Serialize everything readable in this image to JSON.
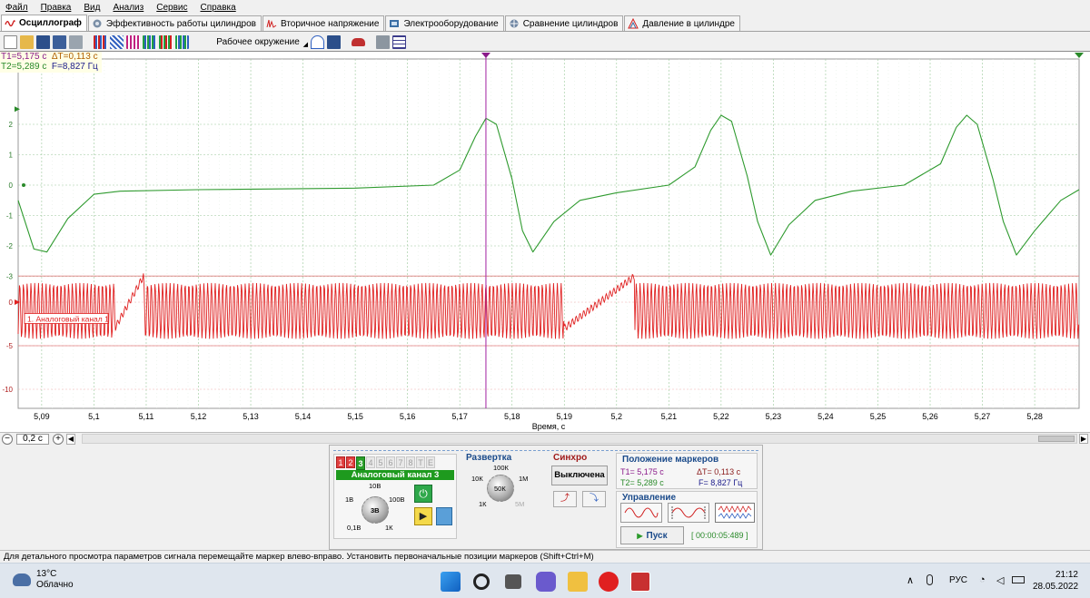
{
  "menu": [
    "Файл",
    "Правка",
    "Вид",
    "Анализ",
    "Сервис",
    "Справка"
  ],
  "tabs": [
    {
      "label": "Осциллограф",
      "icon": "oscilloscope-icon",
      "active": true
    },
    {
      "label": "Эффективность работы цилиндров",
      "icon": "cylinder-efficiency-icon"
    },
    {
      "label": "Вторичное напряжение",
      "icon": "secondary-voltage-icon"
    },
    {
      "label": "Электрооборудование",
      "icon": "electrical-equipment-icon"
    },
    {
      "label": "Сравнение цилиндров",
      "icon": "cylinder-compare-icon"
    },
    {
      "label": "Давление в цилиндре",
      "icon": "cylinder-pressure-icon"
    }
  ],
  "toolbar": {
    "environment": "Рабочее окружение"
  },
  "markers": {
    "t1": "T1=5,175 c",
    "dt": "ΔT=0,113 c",
    "t2": "T2=5,289 c",
    "f": "F=8,827 Гц"
  },
  "chart_data": {
    "type": "line",
    "xlabel": "Время, с",
    "x_ticks": [
      "5,09",
      "5,1",
      "5,11",
      "5,12",
      "5,13",
      "5,14",
      "5,15",
      "5,16",
      "5,17",
      "5,18",
      "5,19",
      "5,2",
      "5,21",
      "5,22",
      "5,23",
      "5,24",
      "5,25",
      "5,26",
      "5,27",
      "5,28"
    ],
    "xlim": [
      5.0855,
      5.2885
    ],
    "green_y_ticks": [
      "2",
      "1",
      "0",
      "-1",
      "-2",
      "-3"
    ],
    "red_y_ticks": [
      "0",
      "-5",
      "-10"
    ],
    "channel_label": "1. Аналоговый канал 1",
    "cursor_x": 5.175,
    "series": [
      {
        "color": "#2e9a2e",
        "description": "green channel",
        "points": [
          [
            5.0855,
            -0.5
          ],
          [
            5.0885,
            -2.1
          ],
          [
            5.091,
            -2.2
          ],
          [
            5.095,
            -1.1
          ],
          [
            5.1,
            -0.3
          ],
          [
            5.105,
            -0.2
          ],
          [
            5.12,
            -0.15
          ],
          [
            5.15,
            -0.1
          ],
          [
            5.165,
            0
          ],
          [
            5.17,
            0.5
          ],
          [
            5.173,
            1.6
          ],
          [
            5.175,
            2.2
          ],
          [
            5.177,
            2.0
          ],
          [
            5.18,
            0.2
          ],
          [
            5.182,
            -1.5
          ],
          [
            5.184,
            -2.2
          ],
          [
            5.188,
            -1.2
          ],
          [
            5.193,
            -0.5
          ],
          [
            5.2,
            -0.25
          ],
          [
            5.21,
            0
          ],
          [
            5.215,
            0.6
          ],
          [
            5.218,
            1.8
          ],
          [
            5.22,
            2.3
          ],
          [
            5.222,
            2.1
          ],
          [
            5.225,
            0.3
          ],
          [
            5.227,
            -1.2
          ],
          [
            5.2295,
            -2.3
          ],
          [
            5.233,
            -1.3
          ],
          [
            5.238,
            -0.5
          ],
          [
            5.245,
            -0.2
          ],
          [
            5.255,
            0
          ],
          [
            5.262,
            0.7
          ],
          [
            5.265,
            1.9
          ],
          [
            5.267,
            2.3
          ],
          [
            5.269,
            2.0
          ],
          [
            5.272,
            0.2
          ],
          [
            5.274,
            -1.2
          ],
          [
            5.2765,
            -2.3
          ],
          [
            5.28,
            -1.5
          ],
          [
            5.285,
            -0.5
          ],
          [
            5.2885,
            -0.15
          ]
        ]
      },
      {
        "color": "#e02020",
        "description": "red channel",
        "amplitude": 6,
        "freq_hz": 1390
      }
    ]
  },
  "panel": {
    "channel_numbers": [
      "1",
      "2",
      "3",
      "4",
      "5",
      "6",
      "7",
      "8",
      "T",
      "E"
    ],
    "channel_title": "Аналоговый канал 3",
    "range_labels": [
      "10В",
      "1В",
      "100В",
      "3В",
      "0,1В",
      "1К"
    ],
    "sweep_title": "Развертка",
    "sweep_labels": [
      "100К",
      "10К",
      "1М",
      "50К",
      "1К",
      "5М"
    ],
    "sync_title": "Синхро",
    "sync_state": "Выключена",
    "markers_title": "Положение маркеров",
    "markers_t1": "T1= 5,175 c",
    "markers_dt": "ΔT= 0,113 c",
    "markers_t2": "T2= 5,289 c",
    "markers_f": "F= 8,827 Гц",
    "control_title": "Управление",
    "start_label": "Пуск",
    "timer": "[ 00:00:05:489 ]"
  },
  "zoom": "0,2 с",
  "status": "Для детального просмотра параметров сигнала перемещайте маркер влево-вправо. Установить первоначальные позиции маркеров (Shift+Ctrl+M)",
  "taskbar": {
    "temp": "13°C",
    "weather": "Облачно",
    "lang": "РУС",
    "time": "21:12",
    "date": "28.05.2022"
  }
}
